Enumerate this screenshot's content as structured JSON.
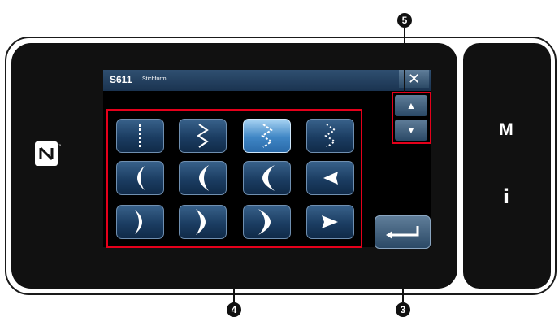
{
  "title": {
    "code": "S611",
    "text": "Stichform"
  },
  "buttons": {
    "close": "✕",
    "scroll_up": "▲",
    "scroll_down": "▼",
    "mode": "M",
    "info": "i"
  },
  "callouts": {
    "grid": "4",
    "scroll": "5",
    "enter": "3"
  },
  "stitch_patterns": [
    {
      "row": 1,
      "shape": "straight",
      "selected": false
    },
    {
      "row": 1,
      "shape": "zigzag",
      "selected": false
    },
    {
      "row": 1,
      "shape": "zigzag-dotted",
      "selected": true
    },
    {
      "row": 1,
      "shape": "zigzag-sparse",
      "selected": false
    },
    {
      "row": 2,
      "shape": "crescent-left-small",
      "selected": false
    },
    {
      "row": 2,
      "shape": "crescent-left",
      "selected": false
    },
    {
      "row": 2,
      "shape": "crescent-left-large",
      "selected": false
    },
    {
      "row": 2,
      "shape": "arrow-left",
      "selected": false
    },
    {
      "row": 3,
      "shape": "crescent-right-small",
      "selected": false
    },
    {
      "row": 3,
      "shape": "crescent-right",
      "selected": false
    },
    {
      "row": 3,
      "shape": "crescent-right-large",
      "selected": false
    },
    {
      "row": 3,
      "shape": "arrow-right",
      "selected": false
    }
  ],
  "colors": {
    "highlight": "#e5001b",
    "button": "#2b4966",
    "selected": "#3f86c5"
  }
}
